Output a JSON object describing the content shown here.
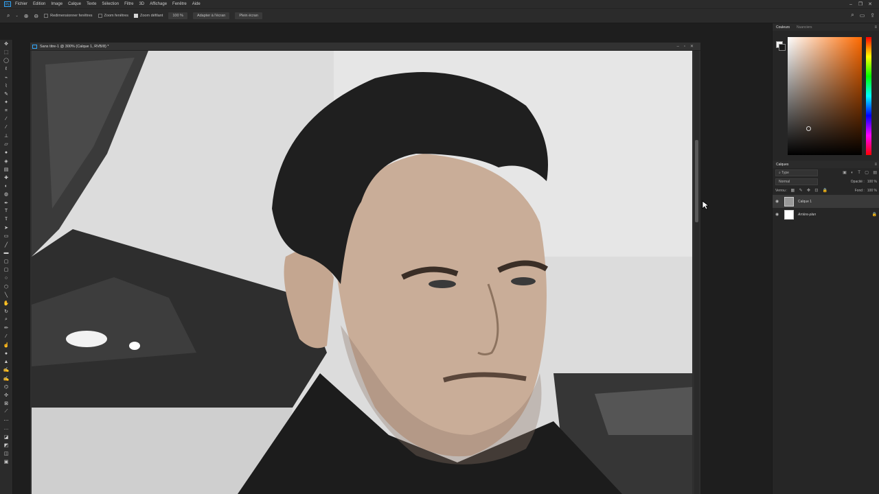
{
  "menu": {
    "app_icon": "Ps",
    "items": [
      "Fichier",
      "Edition",
      "Image",
      "Calque",
      "Texte",
      "Sélection",
      "Filtre",
      "3D",
      "Affichage",
      "Fenêtre",
      "Aide"
    ]
  },
  "options": {
    "resize_windows": "Redimensionner fenêtres",
    "zoom_all": "Zoom fenêtres",
    "scrubby_zoom": "Zoom défilant",
    "zoom_value": "100 %",
    "fit_screen": "Adapter à l'écran",
    "fill_screen": "Plein écran"
  },
  "document": {
    "title": "Sans titre-1 @ 300% (Calque 1, RVB/8) *"
  },
  "panels": {
    "color_tab": "Couleurs",
    "swatches_tab": "Nuanciers",
    "layers_tab": "Calques",
    "kind_filter": "Type",
    "blend_mode": "Normal",
    "opacity_label": "Opacité :",
    "opacity_value": "100 %",
    "lock_label": "Verrou :",
    "fill_label": "Fond :",
    "fill_value": "100 %",
    "layers": [
      {
        "name": "Calque 1"
      },
      {
        "name": "Arrière-plan"
      }
    ]
  },
  "colors": {
    "accent": "#31a8ff",
    "hue_selected": "#ff6a00"
  }
}
